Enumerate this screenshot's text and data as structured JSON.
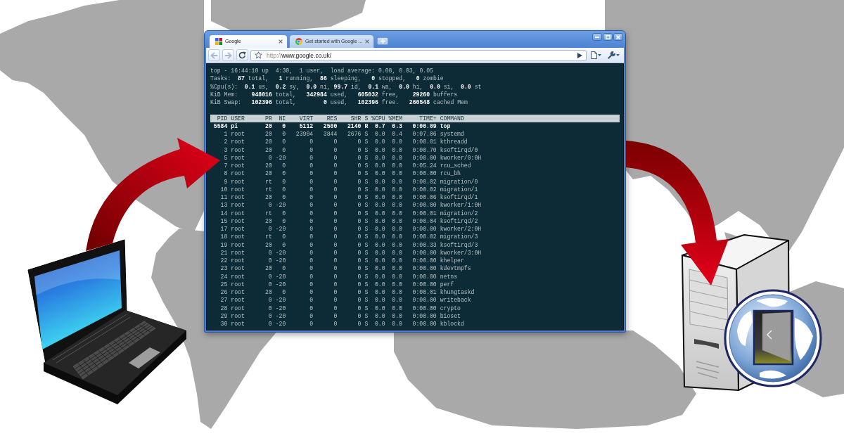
{
  "browser": {
    "tabs": [
      {
        "title": "Google",
        "selected": true
      },
      {
        "title": "Get started with Google ...",
        "selected": false
      }
    ],
    "nav_buttons": [
      {
        "kind": "back",
        "disabled": true
      },
      {
        "kind": "forward",
        "disabled": true
      }
    ],
    "address": {
      "scheme": "http://",
      "host": "www.google.co.uk/"
    }
  },
  "terminal": {
    "summary": [
      "top - 16:44:10 up  4:30,  1 user,  load average: 0.08, 0.03, 0.05",
      "Tasks:  **87** total,   **1** running,  **86** sleeping,   **0** stopped,   **0** zombie",
      "%Cpu(s):  **0.1** us,  **0.2** sy,  **0.0** ni, **99.7** id,  **0.1** wa,  **0.0** hi,  **0.0** si,  **0.0** st",
      "KiB Mem:    **948016** total,   **342984** used,   **605032** free,    **29260** buffers",
      "KiB Swap:   **102396** total,        **0** used,   **102396** free.   **260548** cached Mem"
    ],
    "table": {
      "columns": [
        "PID",
        "USER",
        "PR",
        "NI",
        "VIRT",
        "RES",
        "SHR",
        "S",
        "%CPU",
        "%MEM",
        "TIME+",
        "COMMAND"
      ],
      "rows": [
        {
          "cells": [
            "5584",
            "pi",
            "20",
            "0",
            "5112",
            "2500",
            "2140",
            "R",
            "0.7",
            "0.3",
            "0:00.09",
            "top"
          ],
          "highlighted": true
        },
        {
          "cells": [
            "1",
            "root",
            "20",
            "0",
            "23904",
            "3844",
            "2676",
            "S",
            "0.0",
            "0.4",
            "0:07.06",
            "systemd"
          ],
          "highlighted": false
        },
        {
          "cells": [
            "2",
            "root",
            "20",
            "0",
            "0",
            "0",
            "0",
            "S",
            "0.0",
            "0.0",
            "0:00.01",
            "kthreadd"
          ],
          "highlighted": false
        },
        {
          "cells": [
            "3",
            "root",
            "20",
            "0",
            "0",
            "0",
            "0",
            "S",
            "0.0",
            "0.0",
            "0:00.70",
            "ksoftirqd/0"
          ],
          "highlighted": false
        },
        {
          "cells": [
            "5",
            "root",
            "0",
            "-20",
            "0",
            "0",
            "0",
            "S",
            "0.0",
            "0.0",
            "0:00.00",
            "kworker/0:0H"
          ],
          "highlighted": false
        },
        {
          "cells": [
            "7",
            "root",
            "20",
            "0",
            "0",
            "0",
            "0",
            "S",
            "0.0",
            "0.0",
            "0:05.24",
            "rcu_sched"
          ],
          "highlighted": false
        },
        {
          "cells": [
            "8",
            "root",
            "20",
            "0",
            "0",
            "0",
            "0",
            "S",
            "0.0",
            "0.0",
            "0:00.00",
            "rcu_bh"
          ],
          "highlighted": false
        },
        {
          "cells": [
            "9",
            "root",
            "rt",
            "0",
            "0",
            "0",
            "0",
            "S",
            "0.0",
            "0.0",
            "0:00.02",
            "migration/0"
          ],
          "highlighted": false
        },
        {
          "cells": [
            "10",
            "root",
            "rt",
            "0",
            "0",
            "0",
            "0",
            "S",
            "0.0",
            "0.0",
            "0:00.02",
            "migration/1"
          ],
          "highlighted": false
        },
        {
          "cells": [
            "11",
            "root",
            "20",
            "0",
            "0",
            "0",
            "0",
            "S",
            "0.0",
            "0.0",
            "0:00.06",
            "ksoftirqd/1"
          ],
          "highlighted": false
        },
        {
          "cells": [
            "13",
            "root",
            "0",
            "-20",
            "0",
            "0",
            "0",
            "S",
            "0.0",
            "0.0",
            "0:00.00",
            "kworker/1:0H"
          ],
          "highlighted": false
        },
        {
          "cells": [
            "14",
            "root",
            "rt",
            "0",
            "0",
            "0",
            "0",
            "S",
            "0.0",
            "0.0",
            "0:00.01",
            "migration/2"
          ],
          "highlighted": false
        },
        {
          "cells": [
            "15",
            "root",
            "20",
            "0",
            "0",
            "0",
            "0",
            "S",
            "0.0",
            "0.0",
            "0:00.04",
            "ksoftirqd/2"
          ],
          "highlighted": false
        },
        {
          "cells": [
            "17",
            "root",
            "0",
            "-20",
            "0",
            "0",
            "0",
            "S",
            "0.0",
            "0.0",
            "0:00.00",
            "kworker/2:0H"
          ],
          "highlighted": false
        },
        {
          "cells": [
            "18",
            "root",
            "rt",
            "0",
            "0",
            "0",
            "0",
            "S",
            "0.0",
            "0.0",
            "0:00.02",
            "migration/3"
          ],
          "highlighted": false
        },
        {
          "cells": [
            "19",
            "root",
            "20",
            "0",
            "0",
            "0",
            "0",
            "S",
            "0.0",
            "0.0",
            "0:00.33",
            "ksoftirqd/3"
          ],
          "highlighted": false
        },
        {
          "cells": [
            "21",
            "root",
            "0",
            "-20",
            "0",
            "0",
            "0",
            "S",
            "0.0",
            "0.0",
            "0:00.00",
            "kworker/3:0H"
          ],
          "highlighted": false
        },
        {
          "cells": [
            "22",
            "root",
            "0",
            "-20",
            "0",
            "0",
            "0",
            "S",
            "0.0",
            "0.0",
            "0:00.00",
            "khelper"
          ],
          "highlighted": false
        },
        {
          "cells": [
            "23",
            "root",
            "20",
            "0",
            "0",
            "0",
            "0",
            "S",
            "0.0",
            "0.0",
            "0:00.00",
            "kdevtmpfs"
          ],
          "highlighted": false
        },
        {
          "cells": [
            "24",
            "root",
            "0",
            "-20",
            "0",
            "0",
            "0",
            "S",
            "0.0",
            "0.0",
            "0:00.00",
            "netns"
          ],
          "highlighted": false
        },
        {
          "cells": [
            "25",
            "root",
            "0",
            "-20",
            "0",
            "0",
            "0",
            "S",
            "0.0",
            "0.0",
            "0:00.00",
            "perf"
          ],
          "highlighted": false
        },
        {
          "cells": [
            "26",
            "root",
            "20",
            "0",
            "0",
            "0",
            "0",
            "S",
            "0.0",
            "0.0",
            "0:00.01",
            "khungtaskd"
          ],
          "highlighted": false
        },
        {
          "cells": [
            "27",
            "root",
            "0",
            "-20",
            "0",
            "0",
            "0",
            "S",
            "0.0",
            "0.0",
            "0:00.00",
            "writeback"
          ],
          "highlighted": false
        },
        {
          "cells": [
            "28",
            "root",
            "0",
            "-20",
            "0",
            "0",
            "0",
            "S",
            "0.0",
            "0.0",
            "0:00.00",
            "crypto"
          ],
          "highlighted": false
        },
        {
          "cells": [
            "29",
            "root",
            "0",
            "-20",
            "0",
            "0",
            "0",
            "S",
            "0.0",
            "0.0",
            "0:00.00",
            "bioset"
          ],
          "highlighted": false
        },
        {
          "cells": [
            "30",
            "root",
            "0",
            "-20",
            "0",
            "0",
            "0",
            "S",
            "0.0",
            "0.0",
            "0:00.00",
            "kblockd"
          ],
          "highlighted": false
        }
      ]
    }
  }
}
